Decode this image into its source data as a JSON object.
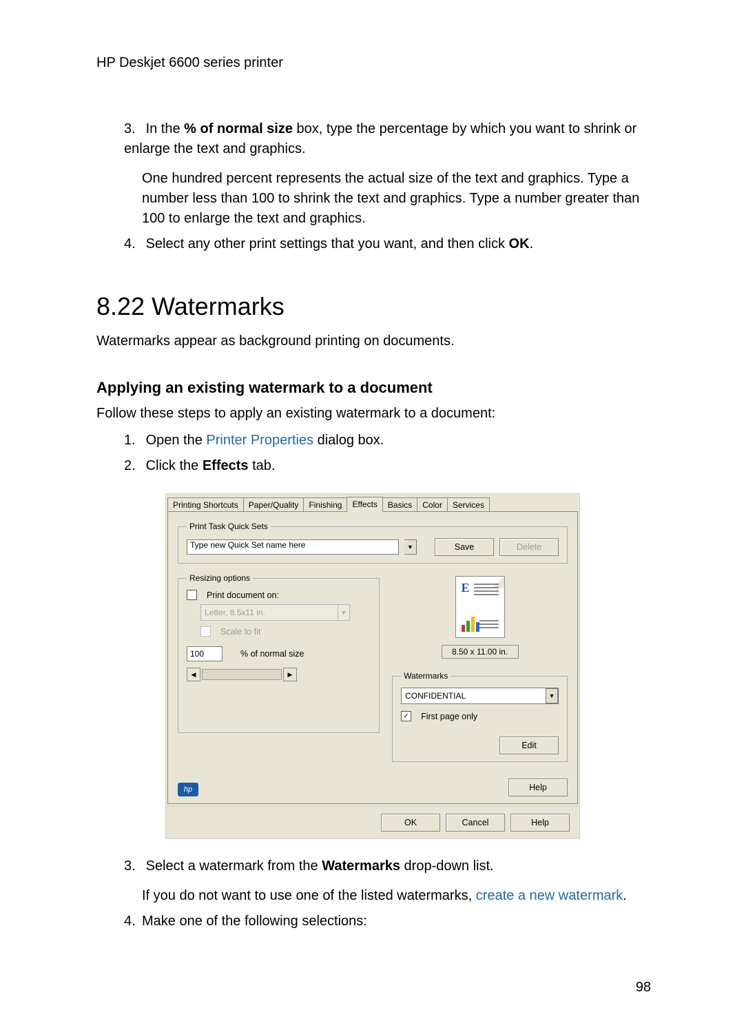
{
  "header": "HP Deskjet 6600 series printer",
  "upper_steps": {
    "s3_before": "In the ",
    "s3_bold": "% of normal size",
    "s3_after": " box, type the percentage by which you want to shrink or enlarge the text and graphics.",
    "s3_para": "One hundred percent represents the actual size of the text and graphics. Type a number less than 100 to shrink the text and graphics. Type a number greater than 100 to enlarge the text and graphics.",
    "s4_before": "Select any other print settings that you want, and then click ",
    "s4_bold": "OK",
    "s4_after": "."
  },
  "section_title": "8.22  Watermarks",
  "section_intro": "Watermarks appear as background printing on documents.",
  "sub_title": "Applying an existing watermark to a document",
  "sub_intro": "Follow these steps to apply an existing watermark to a document:",
  "steps2": {
    "s1_before": "Open the ",
    "s1_link": "Printer Properties",
    "s1_after": " dialog box.",
    "s2_before": "Click the ",
    "s2_bold": "Effects",
    "s2_after": " tab.",
    "s3_before": "Select a watermark from the ",
    "s3_bold": "Watermarks",
    "s3_after": " drop-down list.",
    "s3_p_before": "If you do not want to use one of the listed watermarks, ",
    "s3_p_link": "create a new watermark",
    "s3_p_after": ".",
    "s4": "Make one of the following selections:"
  },
  "dialog": {
    "tabs": [
      "Printing Shortcuts",
      "Paper/Quality",
      "Finishing",
      "Effects",
      "Basics",
      "Color",
      "Services"
    ],
    "active_tab": "Effects",
    "quicksets_legend": "Print Task Quick Sets",
    "quicksets_value": "Type new Quick Set name here",
    "save": "Save",
    "delete": "Delete",
    "resizing_legend": "Resizing options",
    "print_doc_on": "Print document on:",
    "paper_size": "Letter, 8.5x11 in.",
    "scale_to_fit": "Scale to fit",
    "percent_value": "100",
    "percent_label": "% of normal size",
    "dim": "8.50 x 11.00 in.",
    "watermarks_legend": "Watermarks",
    "watermark_value": "CONFIDENTIAL",
    "first_page": "First page only",
    "edit": "Edit",
    "help": "Help",
    "ok": "OK",
    "cancel": "Cancel",
    "help2": "Help"
  },
  "page_number": "98"
}
